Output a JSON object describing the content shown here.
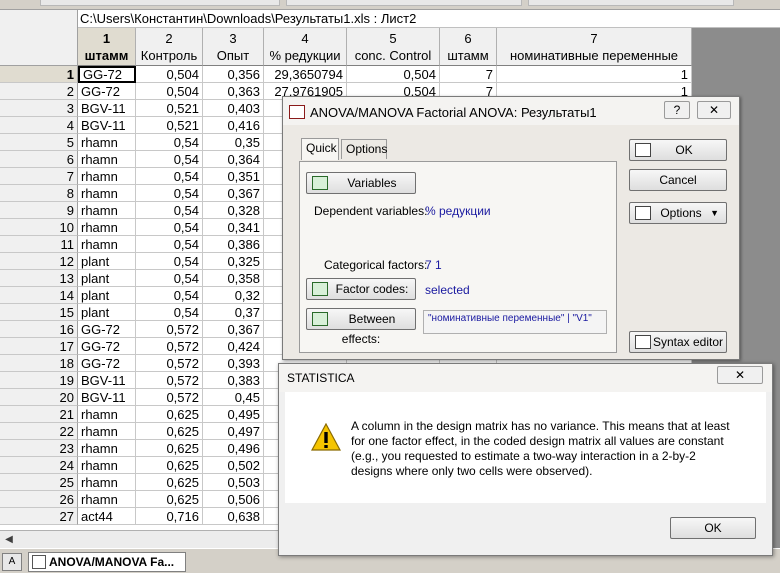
{
  "sheet": {
    "title": "C:\\Users\\Константин\\Downloads\\Результаты1.xls : Лист2",
    "columns": [
      {
        "num": "1",
        "name": "штамм"
      },
      {
        "num": "2",
        "name": "Контроль"
      },
      {
        "num": "3",
        "name": "Опыт"
      },
      {
        "num": "4",
        "name": "% редукции"
      },
      {
        "num": "5",
        "name": "conc. Control"
      },
      {
        "num": "6",
        "name": "штамм"
      },
      {
        "num": "7",
        "name": "номинативные переменные"
      }
    ],
    "rows": [
      {
        "n": "1",
        "c1": "GG-72",
        "c2": "0,504",
        "c3": "0,356",
        "c4": "29,3650794",
        "c5": "0,504",
        "c6": "7",
        "c7": "1"
      },
      {
        "n": "2",
        "c1": "GG-72",
        "c2": "0,504",
        "c3": "0,363",
        "c4": "27,9761905",
        "c5": "0,504",
        "c6": "7",
        "c7": "1"
      },
      {
        "n": "3",
        "c1": "BGV-11",
        "c2": "0,521",
        "c3": "0,403",
        "c4": "",
        "c5": "",
        "c6": "",
        "c7": ""
      },
      {
        "n": "4",
        "c1": "BGV-11",
        "c2": "0,521",
        "c3": "0,416",
        "c4": "",
        "c5": "",
        "c6": "",
        "c7": ""
      },
      {
        "n": "5",
        "c1": "rhamn",
        "c2": "0,54",
        "c3": "0,35",
        "c4": "",
        "c5": "",
        "c6": "",
        "c7": ""
      },
      {
        "n": "6",
        "c1": "rhamn",
        "c2": "0,54",
        "c3": "0,364",
        "c4": "",
        "c5": "",
        "c6": "",
        "c7": ""
      },
      {
        "n": "7",
        "c1": "rhamn",
        "c2": "0,54",
        "c3": "0,351",
        "c4": "",
        "c5": "",
        "c6": "",
        "c7": ""
      },
      {
        "n": "8",
        "c1": "rhamn",
        "c2": "0,54",
        "c3": "0,367",
        "c4": "",
        "c5": "",
        "c6": "",
        "c7": ""
      },
      {
        "n": "9",
        "c1": "rhamn",
        "c2": "0,54",
        "c3": "0,328",
        "c4": "",
        "c5": "",
        "c6": "",
        "c7": ""
      },
      {
        "n": "10",
        "c1": "rhamn",
        "c2": "0,54",
        "c3": "0,341",
        "c4": "",
        "c5": "",
        "c6": "",
        "c7": ""
      },
      {
        "n": "11",
        "c1": "rhamn",
        "c2": "0,54",
        "c3": "0,386",
        "c4": "",
        "c5": "",
        "c6": "",
        "c7": ""
      },
      {
        "n": "12",
        "c1": "plant",
        "c2": "0,54",
        "c3": "0,325",
        "c4": "",
        "c5": "",
        "c6": "",
        "c7": ""
      },
      {
        "n": "13",
        "c1": "plant",
        "c2": "0,54",
        "c3": "0,358",
        "c4": "",
        "c5": "",
        "c6": "",
        "c7": ""
      },
      {
        "n": "14",
        "c1": "plant",
        "c2": "0,54",
        "c3": "0,32",
        "c4": "",
        "c5": "",
        "c6": "",
        "c7": ""
      },
      {
        "n": "15",
        "c1": "plant",
        "c2": "0,54",
        "c3": "0,37",
        "c4": "",
        "c5": "",
        "c6": "",
        "c7": ""
      },
      {
        "n": "16",
        "c1": "GG-72",
        "c2": "0,572",
        "c3": "0,367",
        "c4": "",
        "c5": "",
        "c6": "",
        "c7": ""
      },
      {
        "n": "17",
        "c1": "GG-72",
        "c2": "0,572",
        "c3": "0,424",
        "c4": "",
        "c5": "",
        "c6": "",
        "c7": ""
      },
      {
        "n": "18",
        "c1": "GG-72",
        "c2": "0,572",
        "c3": "0,393",
        "c4": "",
        "c5": "",
        "c6": "",
        "c7": ""
      },
      {
        "n": "19",
        "c1": "BGV-11",
        "c2": "0,572",
        "c3": "0,383",
        "c4": "",
        "c5": "",
        "c6": "",
        "c7": ""
      },
      {
        "n": "20",
        "c1": "BGV-11",
        "c2": "0,572",
        "c3": "0,45",
        "c4": "",
        "c5": "",
        "c6": "",
        "c7": ""
      },
      {
        "n": "21",
        "c1": "rhamn",
        "c2": "0,625",
        "c3": "0,495",
        "c4": "",
        "c5": "",
        "c6": "",
        "c7": ""
      },
      {
        "n": "22",
        "c1": "rhamn",
        "c2": "0,625",
        "c3": "0,497",
        "c4": "",
        "c5": "",
        "c6": "",
        "c7": ""
      },
      {
        "n": "23",
        "c1": "rhamn",
        "c2": "0,625",
        "c3": "0,496",
        "c4": "",
        "c5": "",
        "c6": "",
        "c7": ""
      },
      {
        "n": "24",
        "c1": "rhamn",
        "c2": "0,625",
        "c3": "0,502",
        "c4": "",
        "c5": "",
        "c6": "",
        "c7": ""
      },
      {
        "n": "25",
        "c1": "rhamn",
        "c2": "0,625",
        "c3": "0,503",
        "c4": "",
        "c5": "",
        "c6": "",
        "c7": ""
      },
      {
        "n": "26",
        "c1": "rhamn",
        "c2": "0,625",
        "c3": "0,506",
        "c4": "",
        "c5": "",
        "c6": "",
        "c7": ""
      },
      {
        "n": "27",
        "c1": "act44",
        "c2": "0,716",
        "c3": "0,638",
        "c4": "",
        "c5": "",
        "c6": "",
        "c7": ""
      }
    ]
  },
  "anova": {
    "title": "ANOVA/MANOVA Factorial ANOVA: Результаты1",
    "help": "?",
    "close": "✕",
    "tabs": [
      "Quick",
      "Options"
    ],
    "variables_button": "Variables",
    "dependent_label": "Dependent variables:",
    "dependent_value": "% редукции",
    "categorical_label": "Categorical factors:",
    "categorical_value": "7 1",
    "factor_codes_button": "Factor codes:",
    "factor_codes_value": "selected",
    "between_effects_button": "Between effects:",
    "between_effects_value": "\"номинативные переменные\" | \"V1\"",
    "ok_button": "OK",
    "cancel_button": "Cancel",
    "options_button": "Options",
    "syntax_editor_button": "Syntax editor"
  },
  "statistica": {
    "title": "STATISTICA",
    "close": "✕",
    "message_lines": [
      "A column in the design matrix has no variance. This means that at least",
      "for one factor effect, in the coded design matrix all values are constant",
      "(e.g., you requested to estimate a two-way interaction in a 2-by-2",
      "designs where only two cells were observed)."
    ],
    "ok_button": "OK"
  },
  "taskbar": {
    "item_label": "ANOVA/MANOVA Fa..."
  },
  "colors": {
    "gray_area": "#8c8c8c",
    "value_blue": "#1a1aa0",
    "dialog_bg": "#ece9e4",
    "warning_yellow": "#f5c400"
  }
}
